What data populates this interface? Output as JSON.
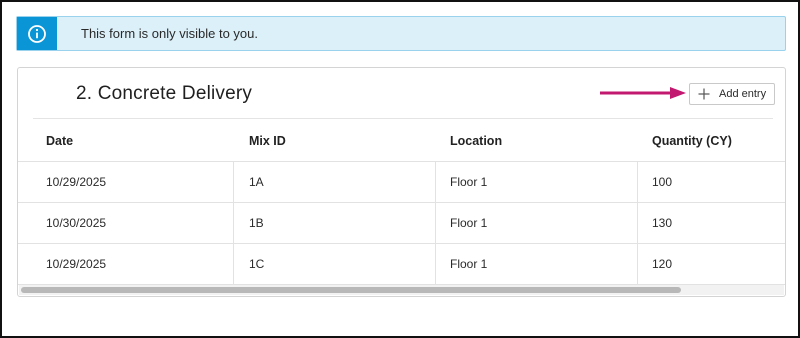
{
  "banner": {
    "message": "This form is only visible to you.",
    "icon": "info-icon",
    "bg_color": "#dcf0fa",
    "icon_color": "#0a96d6"
  },
  "card": {
    "title": "2. Concrete Delivery",
    "add_button_label": "Add entry",
    "add_button_icon": "plus-icon"
  },
  "table": {
    "columns": [
      "Date",
      "Mix ID",
      "Location",
      "Quantity (CY)"
    ],
    "rows": [
      [
        "10/29/2025",
        "1A",
        "Floor 1",
        "100"
      ],
      [
        "10/30/2025",
        "1B",
        "Floor 1",
        "130"
      ],
      [
        "10/29/2025",
        "1C",
        "Floor 1",
        "120"
      ]
    ]
  },
  "annotation": {
    "arrow_color": "#c2186f"
  }
}
